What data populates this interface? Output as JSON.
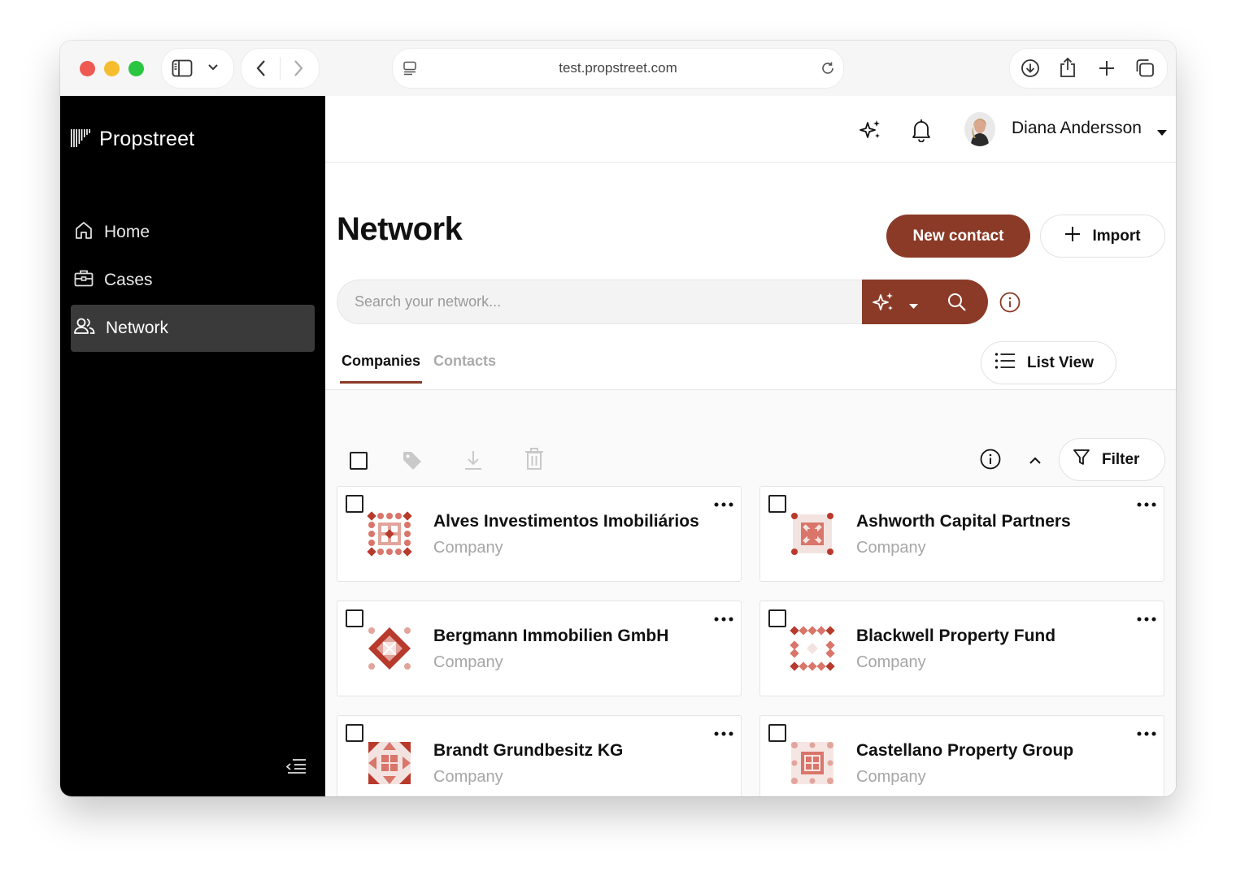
{
  "browser": {
    "url": "test.propstreet.com"
  },
  "sidebar": {
    "brand": "Propstreet",
    "items": [
      {
        "label": "Home",
        "icon": "home-icon",
        "active": false
      },
      {
        "label": "Cases",
        "icon": "briefcase-icon",
        "active": false
      },
      {
        "label": "Network",
        "icon": "users-icon",
        "active": true
      }
    ]
  },
  "header": {
    "user_name": "Diana Andersson"
  },
  "page": {
    "title": "Network",
    "new_contact_label": "New contact",
    "import_label": "Import",
    "search_placeholder": "Search your network...",
    "tabs": [
      {
        "label": "Companies",
        "active": true
      },
      {
        "label": "Contacts",
        "active": false
      }
    ],
    "view_label": "List View",
    "filter_label": "Filter"
  },
  "cards": [
    {
      "title": "Alves Investimentos Imobiliários",
      "subtitle": "Company"
    },
    {
      "title": "Ashworth Capital Partners",
      "subtitle": "Company"
    },
    {
      "title": "Bergmann Immobilien GmbH",
      "subtitle": "Company"
    },
    {
      "title": "Blackwell Property Fund",
      "subtitle": "Company"
    },
    {
      "title": "Brandt Grundbesitz KG",
      "subtitle": "Company"
    },
    {
      "title": "Castellano Property Group",
      "subtitle": "Company"
    }
  ],
  "colors": {
    "accent": "#8a3a27",
    "logo_dark": "#b83a2c",
    "logo_light": "#e2a49b",
    "sidebar_bg": "#000000"
  }
}
